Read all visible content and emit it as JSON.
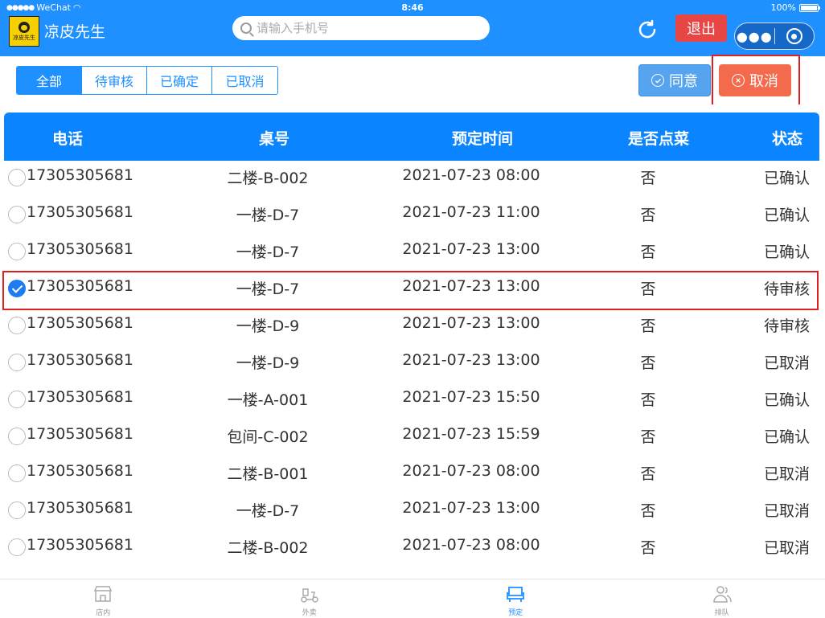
{
  "status": {
    "carrier": "WeChat",
    "time": "8:46",
    "battery": "100%"
  },
  "header": {
    "logo_text": "凉皮先生",
    "title": "凉皮先生",
    "search_placeholder": "请输入手机号",
    "logout_label": "退出"
  },
  "filters": {
    "tabs": [
      {
        "label": "全部",
        "active": true
      },
      {
        "label": "待审核",
        "active": false
      },
      {
        "label": "已确定",
        "active": false
      },
      {
        "label": "已取消",
        "active": false
      }
    ],
    "agree_label": "同意",
    "cancel_label": "取消"
  },
  "table": {
    "columns": [
      "电话",
      "桌号",
      "预定时间",
      "是否点菜",
      "状态"
    ],
    "rows": [
      {
        "phone": "17305305681",
        "table": "二楼-B-002",
        "time": "2021-07-23 08:00",
        "ordered": "否",
        "status": "已确认",
        "selected": false
      },
      {
        "phone": "17305305681",
        "table": "一楼-D-7",
        "time": "2021-07-23 11:00",
        "ordered": "否",
        "status": "已确认",
        "selected": false
      },
      {
        "phone": "17305305681",
        "table": "一楼-D-7",
        "time": "2021-07-23 13:00",
        "ordered": "否",
        "status": "已确认",
        "selected": false
      },
      {
        "phone": "17305305681",
        "table": "一楼-D-7",
        "time": "2021-07-23 13:00",
        "ordered": "否",
        "status": "待审核",
        "selected": true
      },
      {
        "phone": "17305305681",
        "table": "一楼-D-9",
        "time": "2021-07-23 13:00",
        "ordered": "否",
        "status": "待审核",
        "selected": false
      },
      {
        "phone": "17305305681",
        "table": "一楼-D-9",
        "time": "2021-07-23 13:00",
        "ordered": "否",
        "status": "已取消",
        "selected": false
      },
      {
        "phone": "17305305681",
        "table": "一楼-A-001",
        "time": "2021-07-23 15:50",
        "ordered": "否",
        "status": "已确认",
        "selected": false
      },
      {
        "phone": "17305305681",
        "table": "包间-C-002",
        "time": "2021-07-23 15:59",
        "ordered": "否",
        "status": "已确认",
        "selected": false
      },
      {
        "phone": "17305305681",
        "table": "二楼-B-001",
        "time": "2021-07-23 08:00",
        "ordered": "否",
        "status": "已取消",
        "selected": false
      },
      {
        "phone": "17305305681",
        "table": "一楼-D-7",
        "time": "2021-07-23 13:00",
        "ordered": "否",
        "status": "已取消",
        "selected": false
      },
      {
        "phone": "17305305681",
        "table": "二楼-B-002",
        "time": "2021-07-23 08:00",
        "ordered": "否",
        "status": "已取消",
        "selected": false
      }
    ]
  },
  "tabbar": {
    "items": [
      {
        "label": "店内",
        "icon": "store-icon",
        "active": false
      },
      {
        "label": "外卖",
        "icon": "scooter-icon",
        "active": false
      },
      {
        "label": "预定",
        "icon": "chair-icon",
        "active": true
      },
      {
        "label": "排队",
        "icon": "people-icon",
        "active": false
      }
    ]
  }
}
